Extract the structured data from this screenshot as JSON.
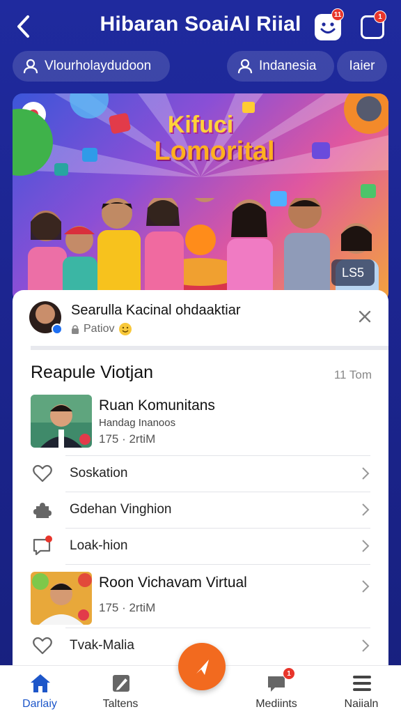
{
  "header": {
    "title": "Hibaran SoaiAl Riial",
    "back_icon": "chevron-left-icon",
    "smile_badge": "11",
    "square_badge": "1"
  },
  "filters": {
    "user_pill": "Vlourholaydudoon",
    "country_pill": "Indanesia",
    "later_pill": "Iaier"
  },
  "hero": {
    "title_line1": "Kifuci",
    "title_line2": "Lomorital",
    "tag": "LS5"
  },
  "post": {
    "author": "Searulla Kacinal ohdaaktiar",
    "meta": "Patiov"
  },
  "section": {
    "title": "Reapule Viotjan",
    "time": "11 Tom"
  },
  "items": [
    {
      "title": "Ruan Komunitans",
      "sub": "Handag Inanoos",
      "stat": "175 · 2rtiM"
    },
    {
      "label": "Soskation",
      "icon": "heart-icon"
    },
    {
      "label": "Gdehan Vinghion",
      "icon": "puzzle-icon"
    },
    {
      "label": "Loak-hion",
      "icon": "chat-icon"
    },
    {
      "title": "Roon Vichavam Virtual",
      "stat": "175 · 2rtiM"
    },
    {
      "label": "Tvak-Malia",
      "icon": "heart-icon"
    }
  ],
  "bottom_nav": [
    {
      "label": "Darlaiy",
      "icon": "home-icon"
    },
    {
      "label": "Taltens",
      "icon": "edit-icon"
    },
    {
      "label": "Mediints",
      "icon": "chat-icon",
      "badge": "1"
    },
    {
      "label": "Naiialn",
      "icon": "menu-icon"
    }
  ],
  "colors": {
    "accent": "#1d56c9",
    "fab": "#f26a1f",
    "header_bg": "#1f2a9e",
    "badge": "#e8352b"
  }
}
